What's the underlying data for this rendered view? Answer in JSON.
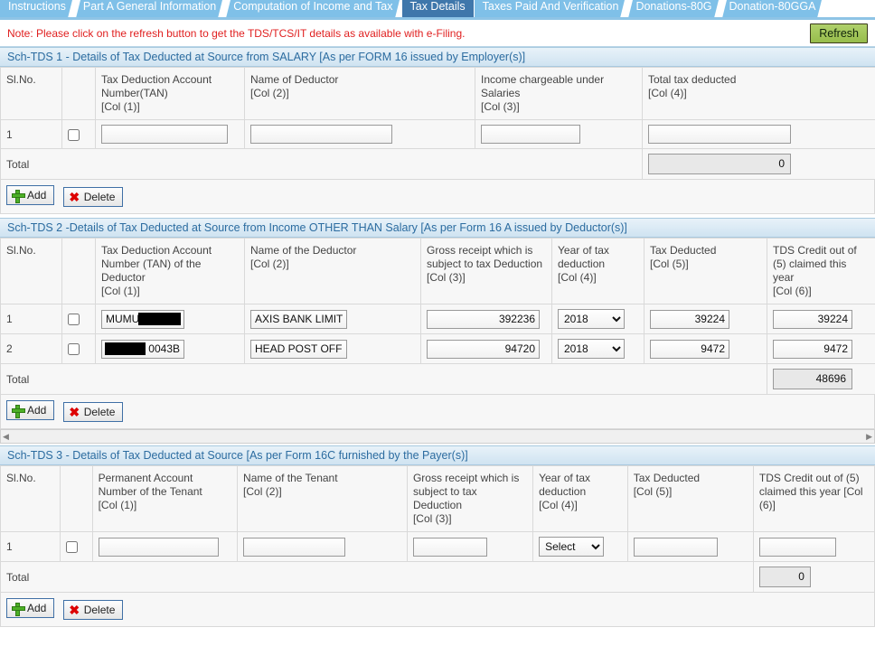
{
  "tabs": [
    {
      "label": "Instructions",
      "active": false
    },
    {
      "label": "Part A General Information",
      "active": false
    },
    {
      "label": "Computation of Income and Tax",
      "active": false
    },
    {
      "label": "Tax Details",
      "active": true
    },
    {
      "label": "Taxes Paid And Verification",
      "active": false
    },
    {
      "label": "Donations-80G",
      "active": false
    },
    {
      "label": "Donation-80GGA",
      "active": false
    }
  ],
  "note": {
    "text": "Note: Please click on the refresh button to get the TDS/TCS/IT details as available with e-Filing.",
    "color": "#e02020",
    "refresh_label": "Refresh",
    "refresh_color": "#a3c75a"
  },
  "buttons": {
    "add_label": "Add",
    "delete_label": "Delete"
  },
  "common": {
    "total_label": "Total",
    "slno_label": "Sl.No."
  },
  "tds1": {
    "heading": "Sch-TDS 1 - Details of Tax Deducted at Source from SALARY [As per FORM 16 issued by Employer(s)]",
    "columns": [
      {
        "title": "Sl.No.",
        "hint": ""
      },
      {
        "title": "Tax Deduction Account Number(TAN)",
        "hint": "[Col (1)]"
      },
      {
        "title": "Name of Deductor",
        "hint": "[Col (2)]"
      },
      {
        "title": "Income chargeable under Salaries",
        "hint": "[Col (3)]"
      },
      {
        "title": "Total tax deducted",
        "hint": "[Col (4)]"
      }
    ],
    "rows": [
      {
        "slno": "1",
        "checked": false,
        "tan": "",
        "name": "",
        "income": "",
        "tax": ""
      }
    ],
    "total": "0"
  },
  "tds2": {
    "heading": "Sch-TDS 2 -Details of Tax Deducted at Source from Income OTHER THAN Salary [As per Form 16 A issued by Deductor(s)]",
    "columns": [
      {
        "title": "Sl.No.",
        "hint": ""
      },
      {
        "title": "Tax Deduction Account Number (TAN) of the Deductor",
        "hint": "[Col (1)]"
      },
      {
        "title": "Name of the Deductor",
        "hint": "[Col (2)]"
      },
      {
        "title": "Gross receipt which is subject to tax Deduction",
        "hint": "[Col (3)]"
      },
      {
        "title": "Year of tax deduction",
        "hint": "[Col (4)]"
      },
      {
        "title": "Tax Deducted",
        "hint": "[Col (5)]"
      },
      {
        "title": "TDS Credit out of (5) claimed this year",
        "hint": "[Col (6)]"
      }
    ],
    "rows": [
      {
        "slno": "1",
        "checked": false,
        "tan": "MUMU0",
        "tan_redacted": "right",
        "name": "AXIS BANK LIMITED",
        "gross": "392236",
        "year": "2018",
        "tax_deducted": "39224",
        "credit": "39224"
      },
      {
        "slno": "2",
        "checked": false,
        "tan": "0043B",
        "tan_redacted": "left",
        "name": "HEAD POST OFFICE",
        "gross": "94720",
        "year": "2018",
        "tax_deducted": "9472",
        "credit": "9472"
      }
    ],
    "year_options": [
      "2018"
    ],
    "total": "48696"
  },
  "tds3": {
    "heading": "Sch-TDS 3 - Details of Tax Deducted at Source [As per Form 16C furnished by the Payer(s)]",
    "columns": [
      {
        "title": "Sl.No.",
        "hint": ""
      },
      {
        "title": "Permanent Account Number of the Tenant",
        "hint": "[Col (1)]"
      },
      {
        "title": "Name of the Tenant",
        "hint": "[Col (2)]"
      },
      {
        "title": "Gross receipt which is subject to tax Deduction",
        "hint": "[Col (3)]"
      },
      {
        "title": "Year of tax deduction",
        "hint": "[Col (4)]"
      },
      {
        "title": "Tax Deducted",
        "hint": "[Col (5)]"
      },
      {
        "title": "TDS Credit out of (5) claimed this year [Col (6)]",
        "hint": ""
      }
    ],
    "rows": [
      {
        "slno": "1",
        "checked": false,
        "pan": "",
        "name": "",
        "gross": "",
        "year": "Select",
        "tax_deducted": "",
        "credit": ""
      }
    ],
    "year_placeholder": "Select",
    "total": "0"
  }
}
